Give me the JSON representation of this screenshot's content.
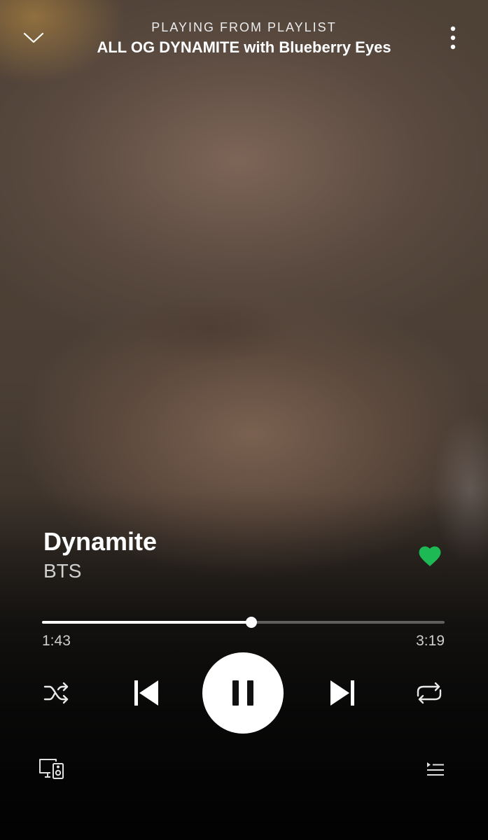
{
  "header": {
    "context_label": "PLAYING FROM PLAYLIST",
    "playlist_name": "ALL OG DYNAMITE with Blueberry Eyes",
    "collapse_icon": "chevron-down-icon",
    "more_icon": "more-vertical-icon"
  },
  "artwork": {
    "description_icon": "album-artwork-background"
  },
  "track": {
    "title": "Dynamite",
    "artist": "BTS",
    "liked": true,
    "like_icon": "heart-filled-icon"
  },
  "playback": {
    "elapsed": "1:43",
    "duration": "3:19",
    "progress_fraction": 0.52
  },
  "controls": {
    "shuffle_icon": "shuffle-icon",
    "previous_icon": "skip-previous-icon",
    "play_pause_icon": "pause-icon",
    "next_icon": "skip-next-icon",
    "repeat_icon": "repeat-icon"
  },
  "footer": {
    "devices_icon": "connect-devices-icon",
    "queue_icon": "queue-icon"
  },
  "colors": {
    "accent": "#1DB954",
    "text_primary": "#FFFFFF",
    "text_secondary": "#CFCFCF",
    "progress_bg": "#5F5F5F"
  }
}
